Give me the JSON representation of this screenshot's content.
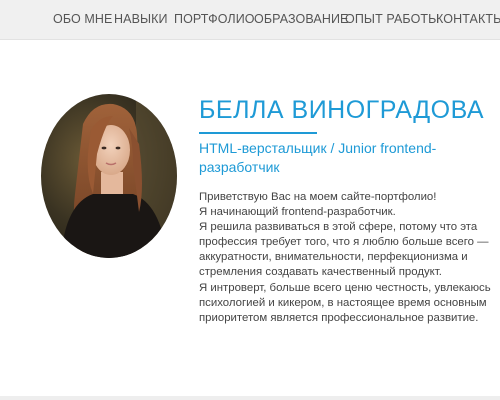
{
  "nav": {
    "items": [
      {
        "label": "ОБО МНЕ"
      },
      {
        "label": "НАВЫКИ"
      },
      {
        "label": "ПОРТФОЛИО"
      },
      {
        "label": "ОБРАЗОВАНИЕ"
      },
      {
        "label": "ОПЫТ РАБОТЫ"
      },
      {
        "label": "КОНТАКТЫ"
      }
    ]
  },
  "profile": {
    "name": "БЕЛЛА ВИНОГРАДОВА",
    "subtitle": "HTML-верстальщик / Junior frontend-разработчик",
    "bio_lines": [
      "Приветствую Вас на моем сайте-портфолио!",
      "Я начинающий frontend-разработчик.",
      "Я решила развиваться в этой сфере, потому что эта",
      "профессия требует того, что я люблю больше всего —",
      "аккуратности, внимательности, перфекционизма и",
      "стремления создавать качественный продукт.",
      "Я интроверт, больше всего ценю честность, увлекаюсь",
      "психологией и кикером, в настоящее время основным",
      "приоритетом является профессиональное развитие."
    ]
  },
  "colors": {
    "accent": "#1e9ad6",
    "nav_background": "#f0f0f0",
    "text": "#444444"
  }
}
